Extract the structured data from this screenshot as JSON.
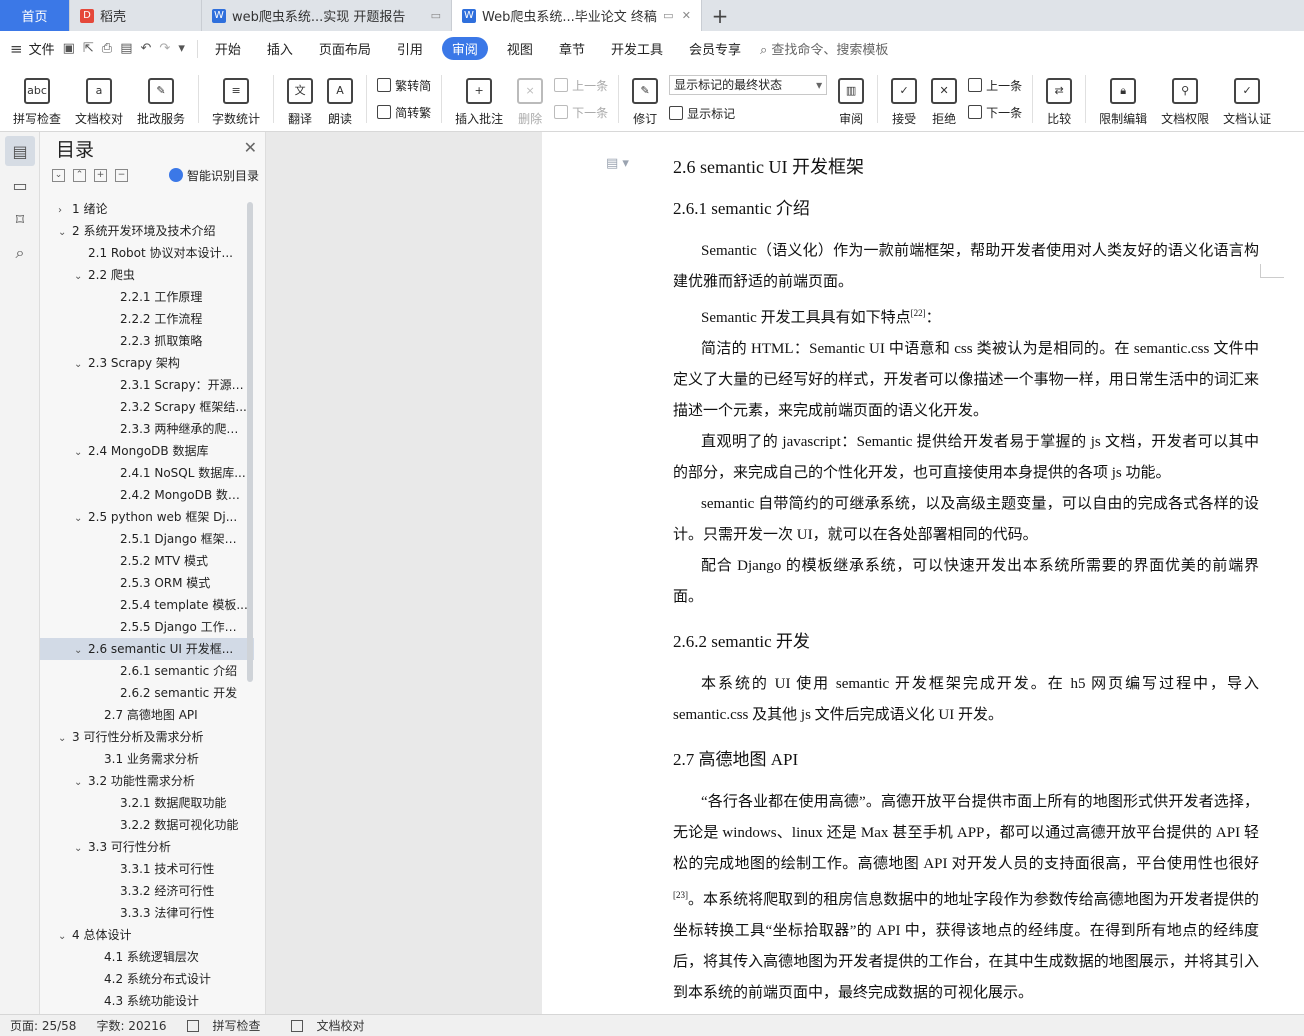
{
  "tabs": {
    "home": "首页",
    "wps": "稻壳",
    "doc1": "web爬虫系统...实现 开题报告",
    "doc2": "Web爬虫系统...毕业论文 终稿"
  },
  "menu": {
    "file": "文件",
    "items": [
      "开始",
      "插入",
      "页面布局",
      "引用",
      "审阅",
      "视图",
      "章节",
      "开发工具",
      "会员专享"
    ],
    "search": "查找命令、搜索模板"
  },
  "ribbon": {
    "spell": "拼写检查",
    "doc_check": "文档校对",
    "batch": "批改服务",
    "word_count": "字数统计",
    "translate": "翻译",
    "read": "朗读",
    "trad": "繁转简",
    "simp": "简转繁",
    "insert_comment": "插入批注",
    "delete": "删除",
    "prev": "上一条",
    "next": "下一条",
    "revise": "修订",
    "markup_select": "显示标记的最终状态",
    "show_markup": "显示标记",
    "review": "审阅",
    "accept": "接受",
    "reject": "拒绝",
    "prev2": "上一条",
    "next2": "下一条",
    "compare": "比较",
    "restrict": "限制编辑",
    "permission": "文档权限",
    "certify": "文档认证"
  },
  "toc": {
    "title": "目录",
    "smart": "智能识别目录",
    "items": [
      {
        "t": "1  绪论",
        "lvl": "l1",
        "ar": "›"
      },
      {
        "t": "2  系统开发环境及技术介绍",
        "lvl": "l1",
        "ar": "⌄"
      },
      {
        "t": "2.1 Robot 协议对本设计...",
        "lvl": "l2c",
        "ar": ""
      },
      {
        "t": "2.2  爬虫",
        "lvl": "l2c",
        "ar": "⌄"
      },
      {
        "t": "2.2.1  工作原理",
        "lvl": "l3",
        "ar": ""
      },
      {
        "t": "2.2.2  工作流程",
        "lvl": "l3",
        "ar": ""
      },
      {
        "t": "2.2.3  抓取策略",
        "lvl": "l3",
        "ar": ""
      },
      {
        "t": "2.3 Scrapy 架构",
        "lvl": "l2c",
        "ar": "⌄"
      },
      {
        "t": "2.3.1 Scrapy：开源爬...",
        "lvl": "l3",
        "ar": ""
      },
      {
        "t": "2.3.2 Scrapy 框架结...",
        "lvl": "l3",
        "ar": ""
      },
      {
        "t": "2.3.3  两种继承的爬虫...",
        "lvl": "l3",
        "ar": ""
      },
      {
        "t": "2.4 MongoDB 数据库",
        "lvl": "l2c",
        "ar": "⌄"
      },
      {
        "t": "2.4.1 NoSQL 数据库...",
        "lvl": "l3",
        "ar": ""
      },
      {
        "t": "2.4.2 MongoDB 数据...",
        "lvl": "l3",
        "ar": ""
      },
      {
        "t": "2.5 python web 框架 Dj...",
        "lvl": "l2c",
        "ar": "⌄"
      },
      {
        "t": "2.5.1 Django 框架介...",
        "lvl": "l3",
        "ar": ""
      },
      {
        "t": "2.5.2 MTV 模式",
        "lvl": "l3",
        "ar": ""
      },
      {
        "t": "2.5.3 ORM 模式",
        "lvl": "l3",
        "ar": ""
      },
      {
        "t": "2.5.4 template 模板...",
        "lvl": "l3",
        "ar": ""
      },
      {
        "t": "2.5.5 Django 工作机...",
        "lvl": "l3",
        "ar": ""
      },
      {
        "t": "2.6 semantic UI 开发框...",
        "lvl": "l2c",
        "ar": "⌄",
        "cur": true
      },
      {
        "t": "2.6.1 semantic 介绍",
        "lvl": "l3",
        "ar": ""
      },
      {
        "t": "2.6.2 semantic 开发",
        "lvl": "l3",
        "ar": ""
      },
      {
        "t": "2.7  高德地图 API",
        "lvl": "l2",
        "ar": ""
      },
      {
        "t": "3  可行性分析及需求分析",
        "lvl": "l1",
        "ar": "⌄"
      },
      {
        "t": "3.1  业务需求分析",
        "lvl": "l2",
        "ar": ""
      },
      {
        "t": "3.2  功能性需求分析",
        "lvl": "l2c",
        "ar": "⌄"
      },
      {
        "t": "3.2.1  数据爬取功能",
        "lvl": "l3",
        "ar": ""
      },
      {
        "t": "3.2.2  数据可视化功能",
        "lvl": "l3",
        "ar": ""
      },
      {
        "t": "3.3  可行性分析",
        "lvl": "l2c",
        "ar": "⌄"
      },
      {
        "t": "3.3.1  技术可行性",
        "lvl": "l3",
        "ar": ""
      },
      {
        "t": "3.3.2  经济可行性",
        "lvl": "l3",
        "ar": ""
      },
      {
        "t": "3.3.3  法律可行性",
        "lvl": "l3",
        "ar": ""
      },
      {
        "t": "4  总体设计",
        "lvl": "l1",
        "ar": "⌄"
      },
      {
        "t": "4.1  系统逻辑层次",
        "lvl": "l2",
        "ar": ""
      },
      {
        "t": "4.2  系统分布式设计",
        "lvl": "l2",
        "ar": ""
      },
      {
        "t": "4.3  系统功能设计",
        "lvl": "l2",
        "ar": ""
      }
    ]
  },
  "doc": {
    "h_26": "2.6 semantic UI 开发框架",
    "h_261": "2.6.1 semantic 介绍",
    "p1": "Semantic（语义化）作为一款前端框架，帮助开发者使用对人类友好的语义化语言构建优雅而舒适的前端页面。",
    "p2a": "Semantic 开发工具具有如下特点",
    "p2sup": "[22]",
    "p2b": "：",
    "p3": "简洁的 HTML：Semantic UI 中语意和 css 类被认为是相同的。在 semantic.css 文件中定义了大量的已经写好的样式，开发者可以像描述一个事物一样，用日常生活中的词汇来描述一个元素，来完成前端页面的语义化开发。",
    "p4": "直观明了的 javascript：Semantic 提供给开发者易于掌握的 js 文档，开发者可以其中的部分，来完成自己的个性化开发，也可直接使用本身提供的各项 js 功能。",
    "p5": "semantic 自带简约的可继承系统，以及高级主题变量，可以自由的完成各式各样的设计。只需开发一次 UI，就可以在各处部署相同的代码。",
    "p6": "配合 Django 的模板继承系统，可以快速开发出本系统所需要的界面优美的前端界面。",
    "h_262": "2.6.2 semantic 开发",
    "p7": "本系统的 UI 使用 semantic 开发框架完成开发。在 h5 网页编写过程中，导入 semantic.css 及其他 js 文件后完成语义化 UI 开发。",
    "h_27": "2.7  高德地图 API",
    "p8a": "“各行各业都在使用高德”。高德开放平台提供市面上所有的地图形式供开发者选择，无论是 windows、linux 还是 Max 甚至手机 APP，都可以通过高德开放平台提供的 API 轻松的完成地图的绘制工作。高德地图 API 对开发人员的支持面很高，平台使用性也很好",
    "p8sup": "[23]",
    "p8b": "。本系统将爬取到的租房信息数据中的地址字段作为参数传给高德地图为开发者提供的坐标转换工具“坐标拾取器”的 API 中，获得该地点的经纬度。在得到所有地点的经纬度后，将其传入高德地图为开发者提供的工作台，在其中生成数据的地图展示，并将其引入到本系统的前端页面中，最终完成数据的可视化展示。"
  },
  "status": {
    "page": "页面: 25/58",
    "words": "字数: 20216",
    "spell": "拼写检查",
    "check": "文档校对"
  },
  "colors": {
    "accent": "#3b78e7",
    "toc_current": "#d2dae6"
  }
}
